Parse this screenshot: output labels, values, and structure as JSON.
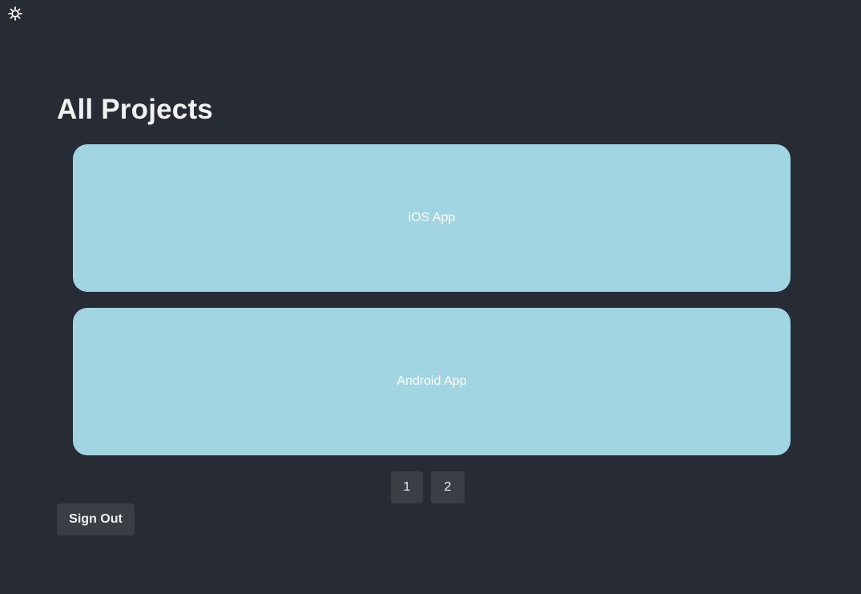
{
  "header": {
    "theme_toggle_icon": "sun-icon",
    "title": "All Projects"
  },
  "projects": [
    {
      "name": "iOS App"
    },
    {
      "name": "Android App"
    }
  ],
  "pagination": {
    "pages": [
      "1",
      "2"
    ]
  },
  "footer": {
    "sign_out_label": "Sign Out"
  },
  "colors": {
    "background": "#272b33",
    "card": "#a2d5e2",
    "button": "#3a3e45",
    "text": "#f0f0f0"
  }
}
